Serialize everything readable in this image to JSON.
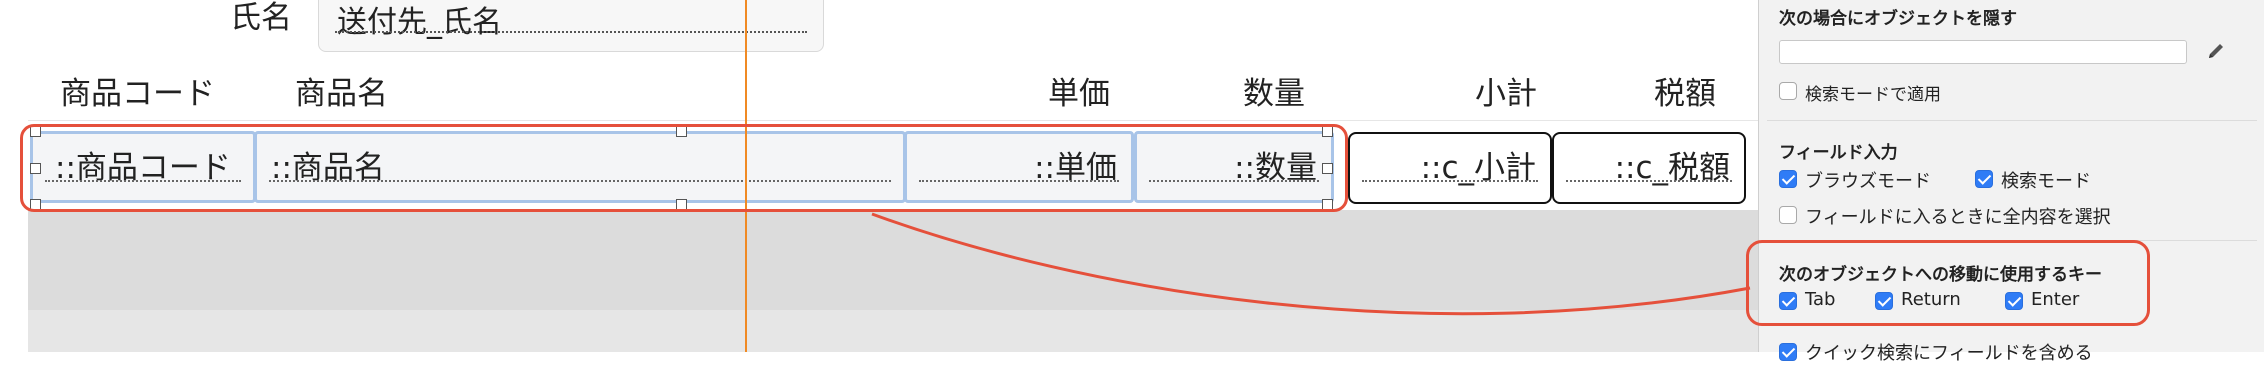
{
  "layout": {
    "header_field_label": "氏名",
    "header_field_value": "送付先_氏名",
    "column_headers": {
      "code": "商品コード",
      "name": "商品名",
      "price": "単価",
      "qty": "数量",
      "subtotal": "小計",
      "tax": "税額"
    },
    "fields": {
      "code": "::商品コード",
      "name": "::商品名",
      "price": "::単価",
      "qty": "::数量",
      "subtotal": "::c_小計",
      "tax": "::c_税額"
    }
  },
  "inspector": {
    "hide_heading": "次の場合にオブジェクトを隠す",
    "hide_condition_value": "",
    "apply_find_mode": "検索モードで適用",
    "field_entry_heading": "フィールド入力",
    "browse_mode": "ブラウズモード",
    "find_mode": "検索モード",
    "select_entire_contents": "フィールドに入るときに全内容を選択",
    "go_to_next_heading": "次のオブジェクトへの移動に使用するキー",
    "keys": {
      "tab": "Tab",
      "return": "Return",
      "enter": "Enter"
    },
    "quick_find": "クイック検索にフィールドを含める",
    "checked": {
      "apply_find_mode": false,
      "browse_mode": true,
      "find_mode": true,
      "select_entire_contents": false,
      "tab": true,
      "return": true,
      "enter": true,
      "quick_find": true
    }
  },
  "colors": {
    "highlight": "#e5503b",
    "guide": "#f08a24",
    "checkbox": "#2f7cf6"
  }
}
